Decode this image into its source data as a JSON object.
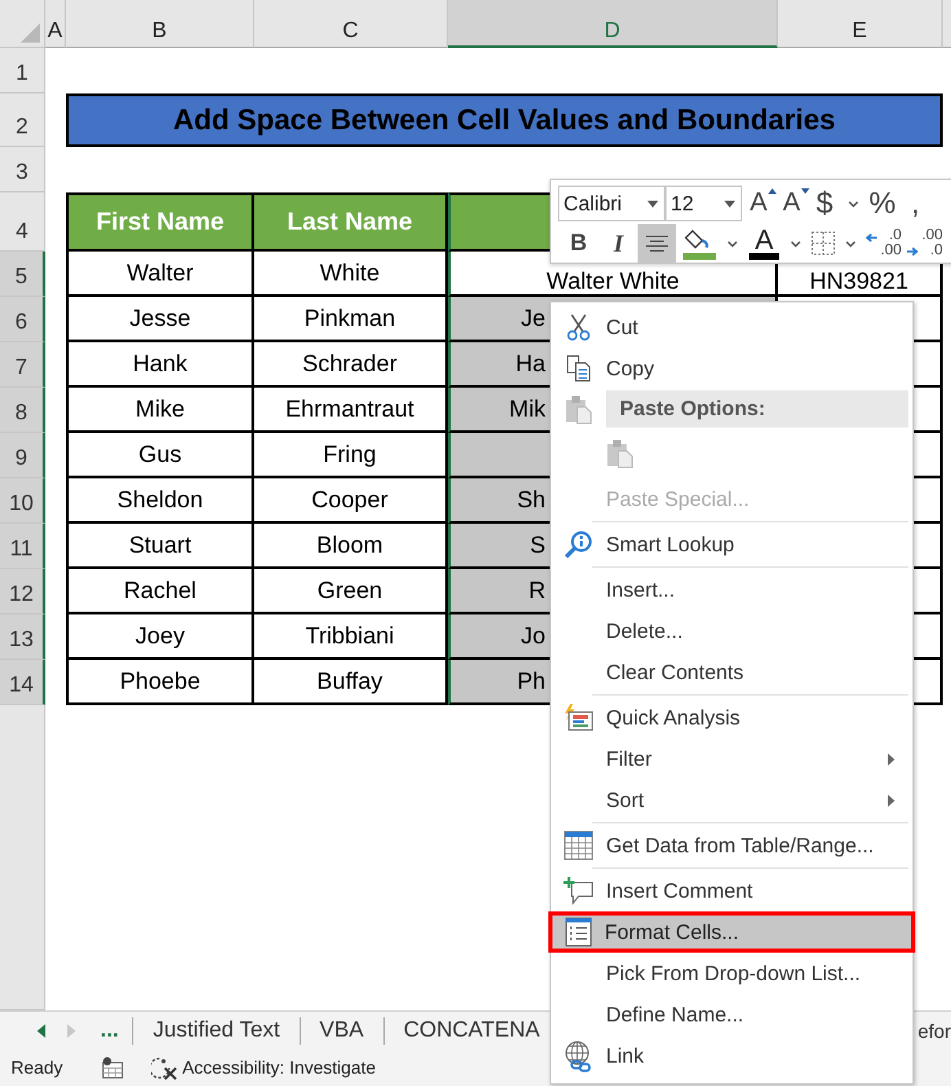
{
  "sheet": {
    "column_headers": [
      {
        "label": "A",
        "selected": false
      },
      {
        "label": "B",
        "selected": false
      },
      {
        "label": "C",
        "selected": false
      },
      {
        "label": "D",
        "selected": true
      },
      {
        "label": "E",
        "selected": false
      }
    ],
    "row_headers": [
      {
        "label": "1",
        "selected": false
      },
      {
        "label": "2",
        "selected": false
      },
      {
        "label": "3",
        "selected": false
      },
      {
        "label": "4",
        "selected": false
      },
      {
        "label": "5",
        "selected": true
      },
      {
        "label": "6",
        "selected": true
      },
      {
        "label": "7",
        "selected": true
      },
      {
        "label": "8",
        "selected": true
      },
      {
        "label": "9",
        "selected": true
      },
      {
        "label": "10",
        "selected": true
      },
      {
        "label": "11",
        "selected": true
      },
      {
        "label": "12",
        "selected": true
      },
      {
        "label": "13",
        "selected": true
      },
      {
        "label": "14",
        "selected": true
      }
    ],
    "title": "Add Space Between Cell Values and Boundaries",
    "table": {
      "header": [
        "First Name",
        "Last Name"
      ],
      "rows": [
        {
          "first_name": "Walter",
          "last_name": "White",
          "full_name": {
            "text": "Walter White",
            "selected": false
          },
          "column_e": "HN39821"
        },
        {
          "first_name": "Jesse",
          "last_name": "Pinkman",
          "full_name": {
            "text": "Je",
            "selected": true
          }
        },
        {
          "first_name": "Hank",
          "last_name": "Schrader",
          "full_name": {
            "text": "Ha",
            "selected": true
          }
        },
        {
          "first_name": "Mike",
          "last_name": "Ehrmantraut",
          "full_name": {
            "text": "Mik",
            "selected": true
          }
        },
        {
          "first_name": "Gus",
          "last_name": "Fring",
          "full_name": {
            "selected": true
          }
        },
        {
          "first_name": "Sheldon",
          "last_name": "Cooper",
          "full_name": {
            "text": "Sh",
            "selected": true
          }
        },
        {
          "first_name": "Stuart",
          "last_name": "Bloom",
          "full_name": {
            "text": "S",
            "selected": true
          }
        },
        {
          "first_name": "Rachel",
          "last_name": "Green",
          "full_name": {
            "text": "R",
            "selected": true
          }
        },
        {
          "first_name": "Joey",
          "last_name": "Tribbiani",
          "full_name": {
            "text": "Jo",
            "selected": true
          }
        },
        {
          "first_name": "Phoebe",
          "last_name": "Buffay",
          "full_name": {
            "text": "Ph",
            "selected": true
          }
        }
      ]
    }
  },
  "mini_toolbar": {
    "font": "Calibri",
    "size": "12",
    "row_1": [
      {
        "kind": "grow",
        "glyph": "A"
      },
      {
        "kind": "shrink",
        "glyph": "A"
      },
      {
        "kind": "glyph",
        "glyph": "$"
      },
      {
        "kind": "dropdown"
      },
      {
        "kind": "glyph",
        "glyph": "%"
      },
      {
        "kind": "glyph",
        "glyph": ","
      }
    ],
    "row_2": [
      {
        "kind": "bold",
        "glyph": "B",
        "pressed": false
      },
      {
        "kind": "italic",
        "glyph": "I",
        "pressed": false
      },
      {
        "kind": "align",
        "pressed": true
      },
      {
        "kind": "fill",
        "color": "#70ad47"
      },
      {
        "kind": "dropdown"
      },
      {
        "kind": "font-color",
        "glyph": "A",
        "color": "#000000"
      },
      {
        "kind": "dropdown"
      },
      {
        "kind": "borders"
      },
      {
        "kind": "dropdown"
      },
      {
        "kind": "increase-decimal",
        "lines": [
          ".0",
          ".00"
        ]
      },
      {
        "kind": "decrease-decimal",
        "lines": [
          ".00",
          ".0"
        ]
      }
    ]
  },
  "context_menu": {
    "groups": [
      [
        {
          "kind": "command",
          "label": "Cut",
          "disabled": false,
          "selected": false,
          "submenu": false
        },
        {
          "kind": "command",
          "label": "Copy",
          "disabled": false,
          "selected": false,
          "submenu": false
        },
        {
          "kind": "header",
          "label": "Paste Options:"
        },
        {
          "kind": "paste-row"
        },
        {
          "kind": "command",
          "label": "Paste Special...",
          "disabled": true,
          "selected": false,
          "submenu": false
        }
      ],
      [
        {
          "kind": "command",
          "label": "Smart Lookup",
          "disabled": false,
          "selected": false,
          "submenu": false
        }
      ],
      [
        {
          "kind": "command",
          "label": "Insert...",
          "disabled": false,
          "selected": false,
          "submenu": false
        },
        {
          "kind": "command",
          "label": "Delete...",
          "disabled": false,
          "selected": false,
          "submenu": false
        },
        {
          "kind": "command",
          "label": "Clear Contents",
          "disabled": false,
          "selected": false,
          "submenu": false
        }
      ],
      [
        {
          "kind": "command",
          "label": "Quick Analysis",
          "disabled": false,
          "selected": false,
          "submenu": false
        },
        {
          "kind": "command",
          "label": "Filter",
          "disabled": false,
          "selected": false,
          "submenu": true
        },
        {
          "kind": "command",
          "label": "Sort",
          "disabled": false,
          "selected": false,
          "submenu": true
        }
      ],
      [
        {
          "kind": "command",
          "label": "Get Data from Table/Range...",
          "disabled": false,
          "selected": false,
          "submenu": false
        }
      ],
      [
        {
          "kind": "command",
          "label": "Insert Comment",
          "disabled": false,
          "selected": false,
          "submenu": false
        },
        {
          "kind": "command",
          "label": "Format Cells...",
          "disabled": false,
          "selected": true,
          "submenu": false
        },
        {
          "kind": "command",
          "label": "Pick From Drop-down List...",
          "disabled": false,
          "selected": false,
          "submenu": false
        },
        {
          "kind": "command",
          "label": "Define Name...",
          "disabled": false,
          "selected": false,
          "submenu": false
        },
        {
          "kind": "command",
          "label": "Link",
          "disabled": false,
          "selected": false,
          "submenu": false
        }
      ]
    ]
  },
  "sheet_tabs": {
    "more": "...",
    "tabs": [
      "Justified Text",
      "VBA",
      "CONCATENA",
      "efor"
    ]
  },
  "status_bar": {
    "status": "Ready",
    "accessibility": "Accessibility: Investigate"
  }
}
